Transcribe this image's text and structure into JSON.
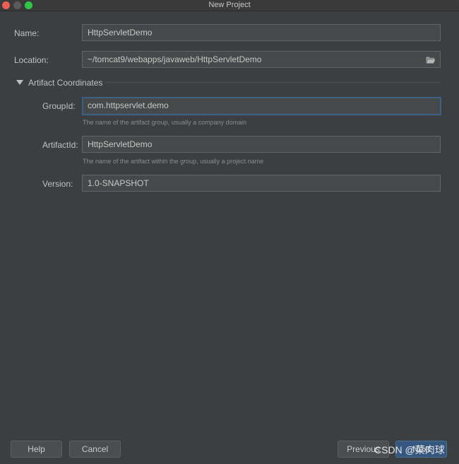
{
  "window": {
    "title": "New Project"
  },
  "form": {
    "name_label": "Name:",
    "name_value": "HttpServletDemo",
    "location_label": "Location:",
    "location_value": "~/tomcat9/webapps/javaweb/HttpServletDemo",
    "section_title": "Artifact Coordinates",
    "groupid_label": "GroupId:",
    "groupid_value": "com.httpservlet.demo",
    "groupid_hint": "The name of the artifact group, usually a company domain",
    "artifactid_label": "ArtifactId:",
    "artifactid_value": "HttpServletDemo",
    "artifactid_hint": "The name of the artifact within the group, usually a project name",
    "version_label": "Version:",
    "version_value": "1.0-SNAPSHOT"
  },
  "buttons": {
    "help": "Help",
    "cancel": "Cancel",
    "previous": "Previous",
    "next": "Next"
  },
  "watermark": "CSDN @菜肉球",
  "icons": {
    "folder": "folder-open-icon",
    "section_toggle": "triangle-down-icon"
  },
  "colors": {
    "background": "#3c3f41",
    "field_background": "#45494a",
    "focus_border": "#3d6185",
    "primary_button": "#365880"
  }
}
